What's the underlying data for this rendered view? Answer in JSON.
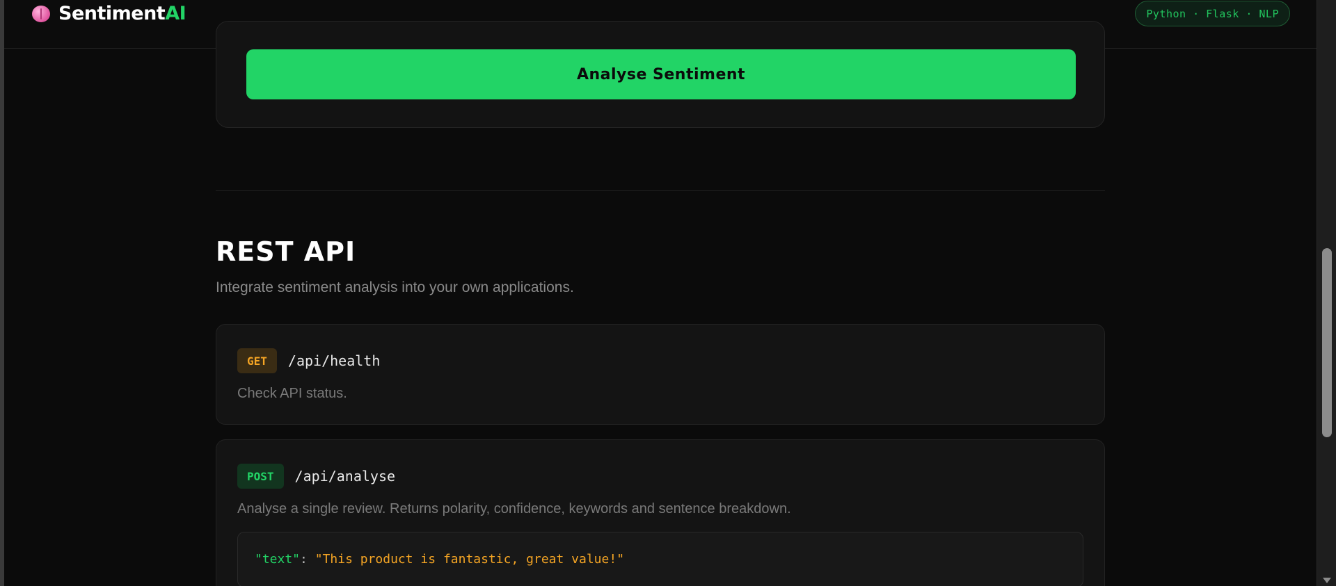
{
  "header": {
    "brand_main": "Sentiment",
    "brand_accent": "AI",
    "tech_badge": "Python · Flask · NLP"
  },
  "analyse": {
    "button_label": "Analyse Sentiment"
  },
  "api_section": {
    "title": "REST API",
    "subtitle": "Integrate sentiment analysis into your own applications.",
    "endpoints": [
      {
        "method": "GET",
        "path": "/api/health",
        "description": "Check API status."
      },
      {
        "method": "POST",
        "path": "/api/analyse",
        "description": "Analyse a single review. Returns polarity, confidence, keywords and sentence breakdown.",
        "code_key": "\"text\"",
        "code_colon": ": ",
        "code_value": "\"This product is fantastic, great value!\""
      }
    ]
  },
  "colors": {
    "accent": "#22d466",
    "get_method": "#f5a524",
    "background": "#0b0b0b"
  }
}
